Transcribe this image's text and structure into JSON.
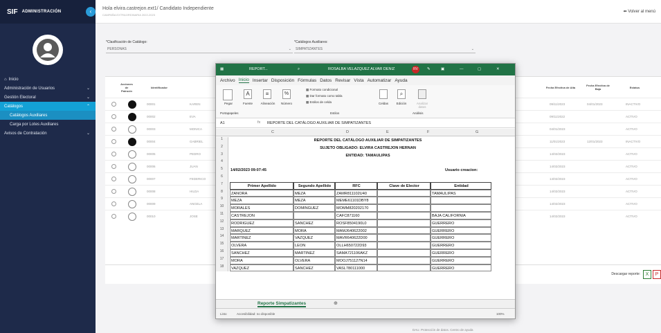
{
  "sidebar": {
    "brand": "SIF",
    "brand_mark": "F",
    "title": "ADMINISTRACIÓN",
    "items": [
      {
        "label": "Inicio"
      },
      {
        "label": "Administración de Usuarios"
      },
      {
        "label": "Gestión Electoral"
      },
      {
        "label": "Catálogos"
      },
      {
        "label": "Catálogos Auxiliares"
      },
      {
        "label": "Carga por Lotes Auxiliares"
      },
      {
        "label": "Avisos de Contratación"
      }
    ]
  },
  "header": {
    "greeting": "Hola elvira.castrejon.ext1/ Candidato Independiente",
    "subtitle": "CAMPAÑA EXTRAORDINARIA 2022-2023",
    "back": "Volver al menú"
  },
  "filters": {
    "class_label": "*Clasificación de Catálogo:",
    "class_value": "PERSONAS",
    "aux_label": "*Catálogos Auxiliares:",
    "aux_value": "SIMPATIZANTES"
  },
  "table": {
    "headers": {
      "acciones": "Acciones de Patrocin",
      "identificador": "Identificador",
      "fecha_alta": "Fecha Efectiva de Alta",
      "fecha_baja": "Fecha Efectiva de Baja",
      "estatus": "Estatus"
    },
    "rows": [
      {
        "id": "00001",
        "name": "KAREN",
        "alta": "09/11/2023",
        "baja": "04/01/2023",
        "estatus": "INACTIVO",
        "dark": true
      },
      {
        "id": "00002",
        "name": "EVA",
        "alta": "09/11/2022",
        "baja": "",
        "estatus": "ACTIVO",
        "dark": true
      },
      {
        "id": "00003",
        "name": "MONICA",
        "alta": "04/01/2023",
        "baja": "",
        "estatus": "ACTIVO",
        "dark": false
      },
      {
        "id": "00004",
        "name": "GABRIEL",
        "alta": "11/01/2023",
        "baja": "12/01/2023",
        "estatus": "INACTIVO",
        "dark": true
      },
      {
        "id": "00005",
        "name": "PEDRO",
        "alta": "14/02/2023",
        "baja": "",
        "estatus": "ACTIVO",
        "dark": false
      },
      {
        "id": "00006",
        "name": "JUAN",
        "alta": "14/02/2023",
        "baja": "",
        "estatus": "ACTIVO",
        "dark": false
      },
      {
        "id": "00007",
        "name": "FEDERICO",
        "alta": "14/02/2023",
        "baja": "",
        "estatus": "ACTIVO",
        "dark": false
      },
      {
        "id": "00008",
        "name": "HILDA",
        "alta": "14/02/2023",
        "baja": "",
        "estatus": "ACTIVO",
        "dark": false
      },
      {
        "id": "00009",
        "name": "ANGELA",
        "alta": "14/02/2023",
        "baja": "",
        "estatus": "ACTIVO",
        "dark": false
      },
      {
        "id": "00010",
        "name": "JOSE",
        "alta": "14/02/2023",
        "baja": "",
        "estatus": "ACTIVO",
        "dark": false
      }
    ],
    "download_label": "Descargar reporte:",
    "excel_glyph": "X",
    "pdf_glyph": "P"
  },
  "footer": "DAU. Protección de datos. Centro de ayuda",
  "excel": {
    "filename": "REPORT...",
    "user": "ROSALBA VELAZQUEZ ALVAR DENIZ",
    "user_initials": "RV",
    "menu": [
      "Archivo",
      "Inicio",
      "Insertar",
      "Disposición",
      "Fórmulas",
      "Datos",
      "Revisar",
      "Vista",
      "Automatizar",
      "Ayuda"
    ],
    "ribbon": {
      "pegar": "Pegar",
      "fuente": "Fuente",
      "alineacion": "Alineación",
      "numero": "Número",
      "formato_cond": "Formato condicional",
      "dar_formato": "Dar formato como tabla",
      "estilos_celda": "Estilos de celda",
      "estilos": "Estilos",
      "celdas": "Celdas",
      "edicion": "Edición",
      "analizar": "Analizar datos",
      "portapapeles": "Portapapeles",
      "analisis": "Análisis"
    },
    "namebox": "A1",
    "fx": "fx",
    "formula": "REPORTE DEL CATÁLOGO AUXILIAR DE SIMPATIZANTES",
    "col_letters": [
      "C",
      "D",
      "E",
      "F",
      "G"
    ],
    "title1": "REPORTE DEL CATÁLOGO AUXILIAR DE SIMPATIZANTES",
    "title2": "SUJETO OBLIGADO: ELVIRA CASTREJON HERNAN",
    "title3": "ENTIDAD: TAMAULIPAS",
    "date": "14/02/2023 09:07:45",
    "user_label": "Usuario creacion:",
    "col_headers": [
      "Primer Apellido",
      "Segundo Apellido",
      "RFC",
      "Clave de Elector",
      "Entidad"
    ],
    "rows": [
      {
        "n": "8",
        "a": "ZANORA",
        "b": "MEZA",
        "c": "ZAMR811102U40",
        "d": "",
        "e": "TAMAULIPAS"
      },
      {
        "n": "9",
        "a": "MEZA",
        "b": "MEZA",
        "c": "MEME61101DBY8",
        "d": "",
        "e": ""
      },
      {
        "n": "10",
        "a": "MORALES",
        "b": "DOMINGUEZ",
        "c": "MOMM820202170",
        "d": "",
        "e": ""
      },
      {
        "n": "11",
        "a": "CASTREJON",
        "b": "",
        "c": "CAFC871160",
        "d": "",
        "e": "BAJA CALIFORNIA"
      },
      {
        "n": "12",
        "a": "RODRIGUEZ",
        "b": "SANCHEZ",
        "c": "ROSF8504190L0",
        "d": "",
        "e": "GUERRERO"
      },
      {
        "n": "13",
        "a": "MARQUEZ",
        "b": "MORA",
        "c": "MAMJ640622002",
        "d": "",
        "e": "GUERRERO"
      },
      {
        "n": "14",
        "a": "MARTINEZ",
        "b": "VAZQUEZ",
        "c": "MAVR640622D00",
        "d": "",
        "e": "GUERRERO"
      },
      {
        "n": "15",
        "a": "OLVERA",
        "b": "LEON",
        "c": "OLLH650722D93",
        "d": "",
        "e": "GUERRERO"
      },
      {
        "n": "16",
        "a": "SANCHEZ",
        "b": "MARTINEZ",
        "c": "SAMA721106AKZ",
        "d": "",
        "e": "GUERRERO"
      },
      {
        "n": "17",
        "a": "MORA",
        "b": "OLVERA",
        "c": "MOOJ751127N14",
        "d": "",
        "e": "GUERRERO"
      },
      {
        "n": "18",
        "a": "VAZQUEZ",
        "b": "SANCHEZ",
        "c": "VASL780111000",
        "d": "",
        "e": "GUERRERO"
      }
    ],
    "sheet_tab": "Reporte Simpatizantes",
    "status_left": "Listo",
    "accessibility": "Accesibilidad: no disponible",
    "zoom": "100%"
  }
}
